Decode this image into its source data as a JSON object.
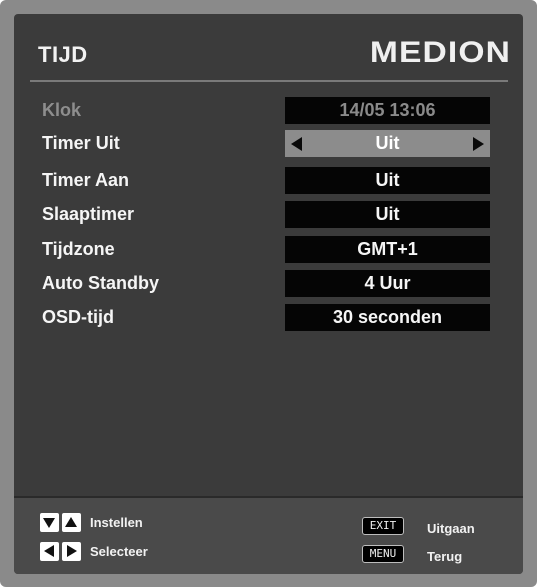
{
  "header": {
    "title": "TIJD",
    "brand": "MEDION"
  },
  "settings": [
    {
      "label": "Klok",
      "value": "14/05   13:06",
      "state": "disabled"
    },
    {
      "label": "Timer Uit",
      "value": "Uit",
      "state": "selected"
    },
    {
      "label": "Timer Aan",
      "value": "Uit",
      "state": "normal"
    },
    {
      "label": "Slaaptimer",
      "value": "Uit",
      "state": "normal"
    },
    {
      "label": "Tijdzone",
      "value": "GMT+1",
      "state": "normal"
    },
    {
      "label": "Auto Standby",
      "value": "4 Uur",
      "state": "normal"
    },
    {
      "label": "OSD-tijd",
      "value": "30 seconden",
      "state": "normal"
    }
  ],
  "footer": {
    "instellen_label": "Instellen",
    "selecteer_label": "Selecteer",
    "exit_key": "EXIT",
    "exit_label": "Uitgaan",
    "menu_key": "MENU",
    "menu_label": "Terug"
  },
  "icons": {
    "up_down_keys": [
      "arrow-down-icon",
      "arrow-up-icon"
    ],
    "left_right_keys": [
      "arrow-left-icon",
      "arrow-right-icon"
    ]
  },
  "colors": {
    "panel": "#3b3b3b",
    "value_box": "#050505",
    "selected_value_box": "#8c8c8c",
    "footer": "#4a4a4a"
  }
}
